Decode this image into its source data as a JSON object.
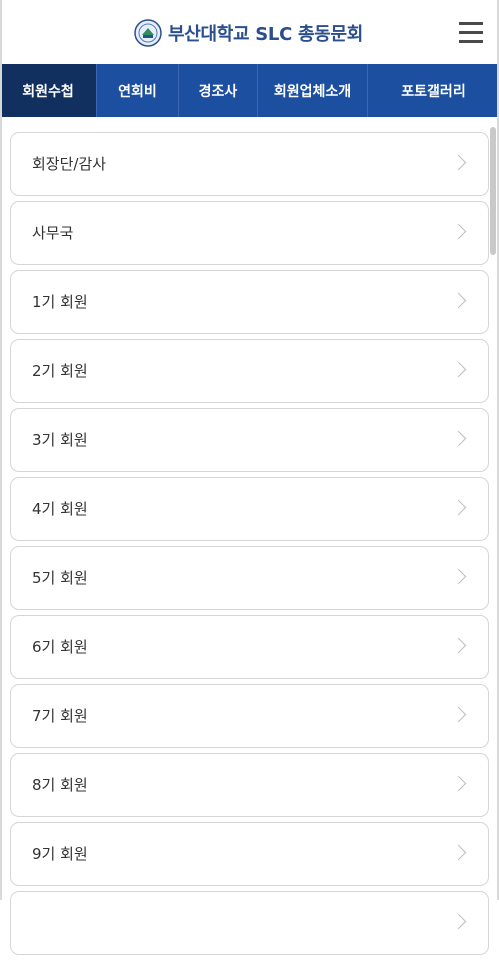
{
  "header": {
    "title": "부산대학교 SLC 총동문회",
    "logo_icon": "university-emblem-icon",
    "menu_icon": "hamburger-menu-icon"
  },
  "nav": {
    "tabs": [
      {
        "label": "회원수첩",
        "active": true
      },
      {
        "label": "연회비"
      },
      {
        "label": "경조사"
      },
      {
        "label": "회원업체소개"
      },
      {
        "label": "포토갤러리"
      }
    ]
  },
  "list": {
    "items": [
      {
        "label": "회장단/감사"
      },
      {
        "label": "사무국"
      },
      {
        "label": "1기 회원"
      },
      {
        "label": "2기 회원"
      },
      {
        "label": "3기 회원"
      },
      {
        "label": "4기 회원"
      },
      {
        "label": "5기 회원"
      },
      {
        "label": "6기 회원"
      },
      {
        "label": "7기 회원"
      },
      {
        "label": "8기 회원"
      },
      {
        "label": "9기 회원"
      },
      {
        "label": ""
      }
    ],
    "chevron_icon": "chevron-right-icon"
  },
  "colors": {
    "nav_bg": "#1d4fa0",
    "nav_active_bg": "#12305f",
    "title_color": "#2a4f8c"
  }
}
